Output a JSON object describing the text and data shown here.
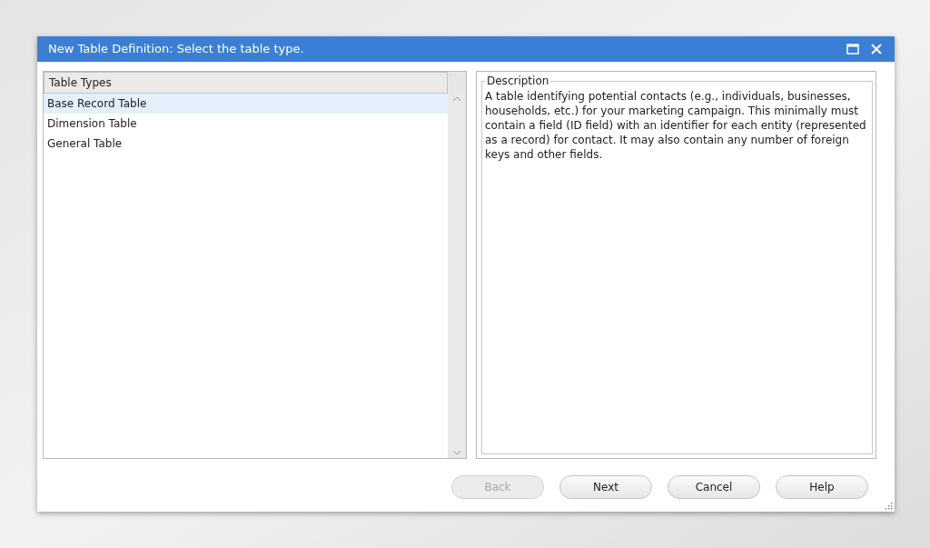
{
  "window": {
    "title": "New Table Definition: Select the table type."
  },
  "table_types": {
    "header": "Table Types",
    "items": [
      {
        "label": "Base Record Table",
        "selected": true
      },
      {
        "label": "Dimension Table",
        "selected": false
      },
      {
        "label": "General Table",
        "selected": false
      }
    ]
  },
  "description": {
    "legend": "Description",
    "text": "A table identifying potential contacts (e.g., individuals, businesses, households, etc.) for your marketing campaign. This minimally must contain a field (ID field) with an identifier for each entity (represented as a record) for contact. It may also contain any number of foreign keys and other fields."
  },
  "buttons": [
    {
      "label": "Back",
      "disabled": true
    },
    {
      "label": "Next",
      "disabled": false
    },
    {
      "label": "Cancel",
      "disabled": false
    },
    {
      "label": "Help",
      "disabled": false
    }
  ]
}
